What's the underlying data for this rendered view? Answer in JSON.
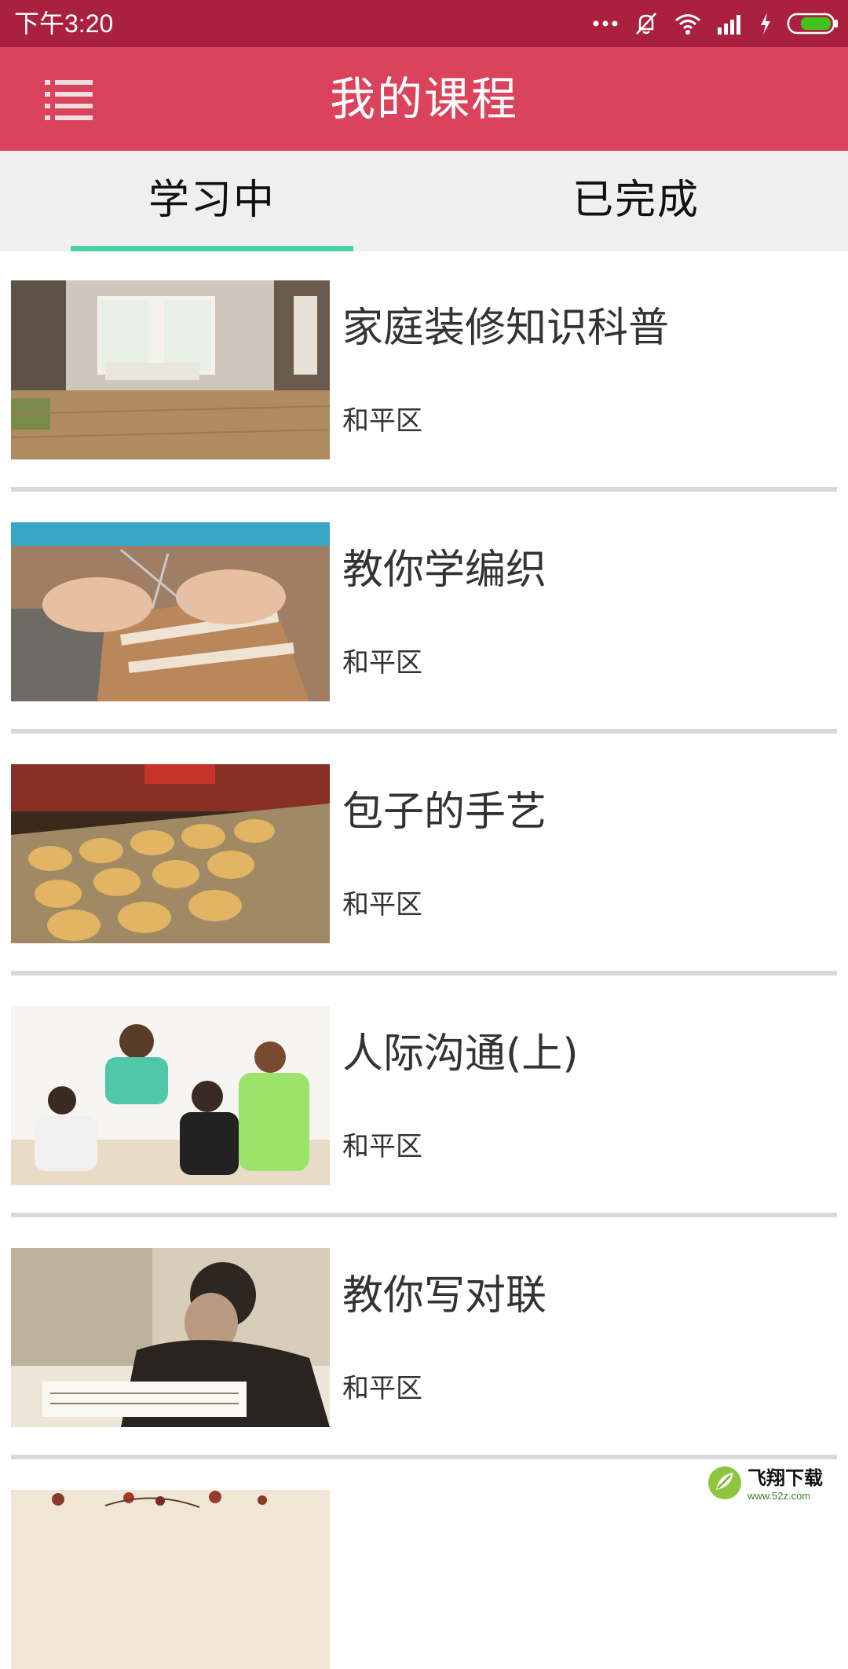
{
  "status_bar": {
    "time": "下午3:20",
    "battery_color": "#43c21c",
    "icons": [
      "more-dots-icon",
      "silent-icon",
      "wifi-icon",
      "signal-icon",
      "charging-icon",
      "battery-icon"
    ]
  },
  "header": {
    "title": "我的课程",
    "menu_icon": "menu-icon",
    "color": "#d9435b"
  },
  "tabs": [
    {
      "label": "学习中",
      "active": true
    },
    {
      "label": "已完成",
      "active": false
    }
  ],
  "tab_indicator_color": "#4ccfa5",
  "courses": [
    {
      "title": "家庭装修知识科普",
      "district": "和平区",
      "image": "living-room-photo"
    },
    {
      "title": "教你学编织",
      "district": "和平区",
      "image": "knitting-photo"
    },
    {
      "title": "包子的手艺",
      "district": "和平区",
      "image": "steamed-buns-photo"
    },
    {
      "title": "人际沟通(上)",
      "district": "和平区",
      "image": "group-conversation-photo"
    },
    {
      "title": "教你写对联",
      "district": "和平区",
      "image": "calligraphy-photo"
    },
    {
      "title": "",
      "district": "",
      "image": "floral-photo"
    }
  ],
  "watermark": {
    "name": "飞翔下载",
    "url": "www.52z.com"
  }
}
